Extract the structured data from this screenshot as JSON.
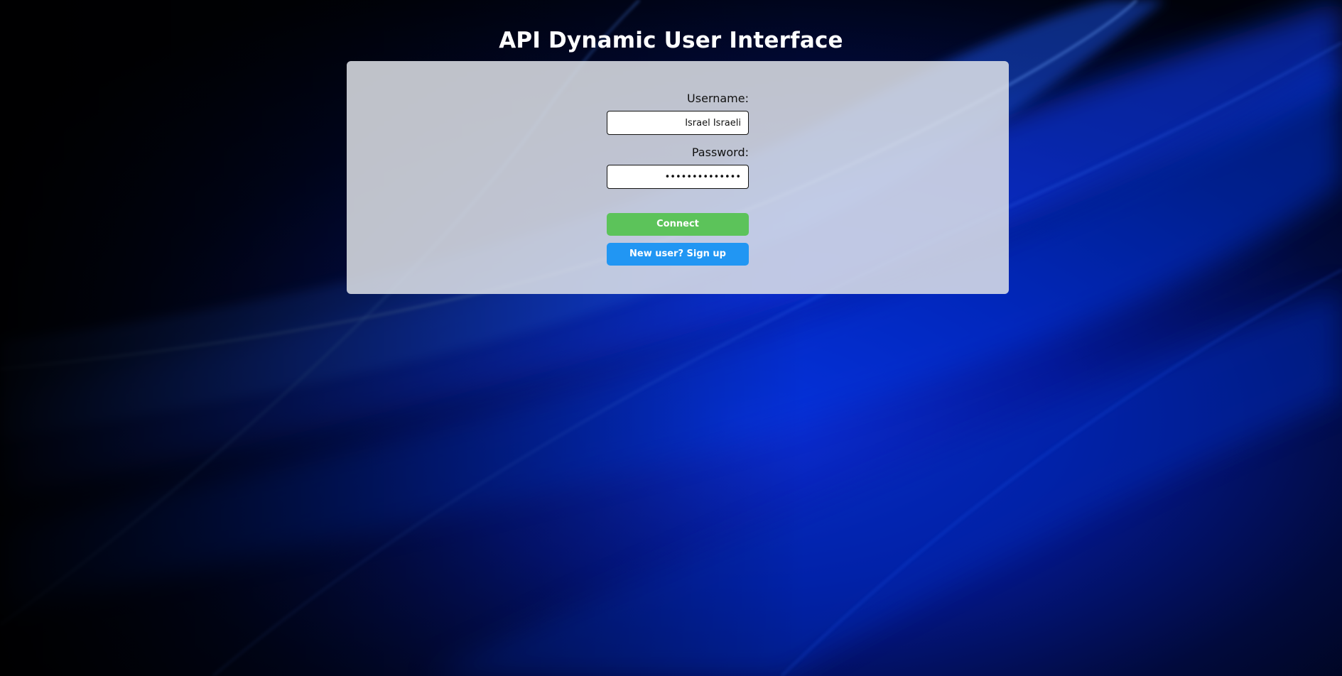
{
  "header": {
    "title": "API Dynamic User Interface"
  },
  "login_form": {
    "username_label": "Username:",
    "username_value": "Israel Israeli",
    "password_label": "Password:",
    "password_value": "••••••••••••••",
    "connect_label": "Connect",
    "signup_label": "New user? Sign up"
  },
  "colors": {
    "connect_button": "#5cc35a",
    "signup_button": "#2196f3",
    "panel": "#dee2e8",
    "background_dark": "#00030f",
    "background_accent": "#0a3cff"
  }
}
